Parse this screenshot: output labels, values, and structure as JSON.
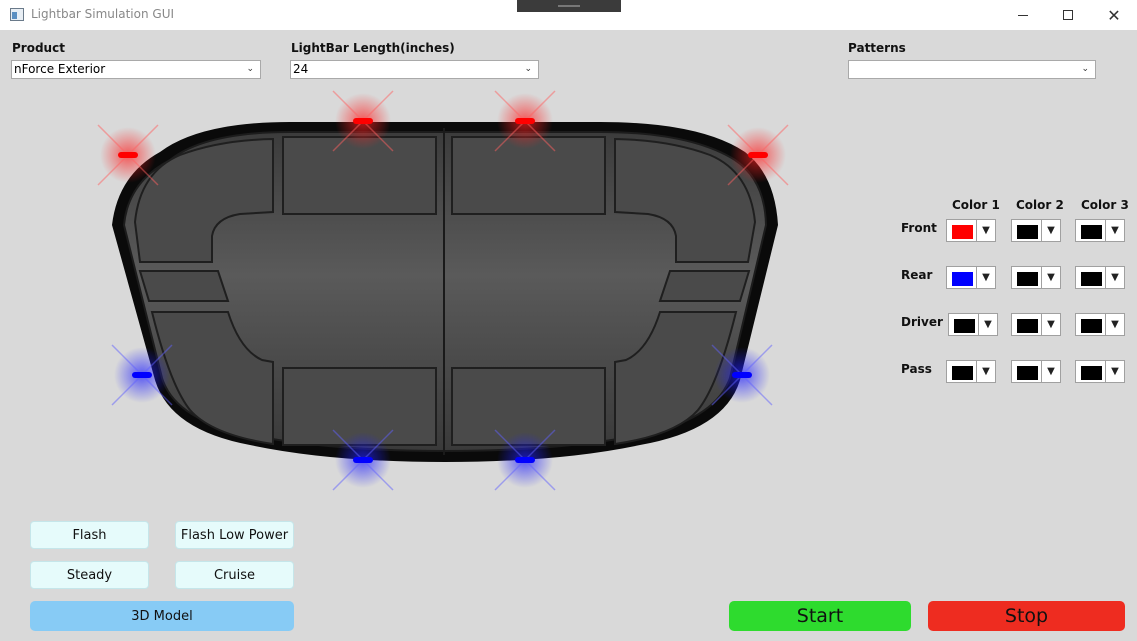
{
  "window": {
    "title": "Lightbar Simulation GUI",
    "controls": [
      "minimize",
      "maximize",
      "close"
    ]
  },
  "fields": {
    "product_label": "Product",
    "product_value": "nForce Exterior",
    "length_label": "LightBar Length(inches)",
    "length_value": "24",
    "patterns_label": "Patterns",
    "patterns_value": ""
  },
  "color_table": {
    "headers": [
      "Color 1",
      "Color 2",
      "Color 3"
    ],
    "rows": [
      {
        "label": "Front",
        "colors": [
          "#ff0000",
          "#000000",
          "#000000"
        ]
      },
      {
        "label": "Rear",
        "colors": [
          "#0000ff",
          "#000000",
          "#000000"
        ]
      },
      {
        "label": "Driver",
        "colors": [
          "#000000",
          "#000000",
          "#000000"
        ]
      },
      {
        "label": "Pass",
        "colors": [
          "#000000",
          "#000000",
          "#000000"
        ]
      }
    ]
  },
  "lights": {
    "front_color": "#ff0000",
    "rear_color": "#0000ff"
  },
  "buttons": {
    "flash": "Flash",
    "flash_low_power": "Flash Low Power",
    "steady": "Steady",
    "cruise": "Cruise",
    "model_3d": "3D Model",
    "start": "Start",
    "stop": "Stop"
  },
  "colors": {
    "start": "#2edb2e",
    "stop": "#ee2c20",
    "model_3d": "#87cbf5",
    "pattern_button": "#e6fbfb"
  }
}
